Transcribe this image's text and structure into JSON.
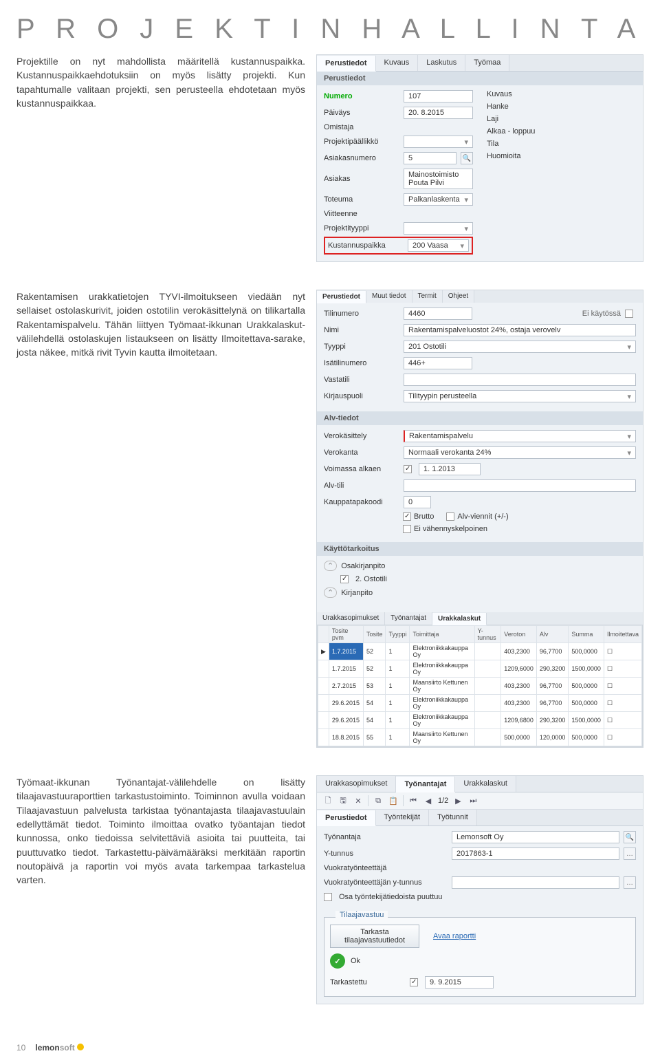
{
  "page": {
    "title_display": "P R O J E K T I N H A L L I N T A",
    "para1": "Projektille on nyt mahdollista määritellä kustannuspaikka. Kustannuspaikkaehdotuksiin on myös lisätty projekti. Kun tapahtumalle valitaan projekti, sen perusteella ehdotetaan myös kustannuspaikkaa.",
    "para2": "Rakentamisen urakkatietojen TYVI-ilmoitukseen viedään nyt sellaiset ostolaskurivit, joiden ostotilin verokäsittelynä on tilikartalla Rakentamispalvelu. Tähän liittyen Työmaat-ikkunan Urakkalaskut-välilehdellä ostolaskujen listaukseen on lisätty Ilmoitettava-sarake, josta näkee, mitkä rivit Tyvin kautta ilmoitetaan.",
    "para3": "Työmaat-ikkunan Työnantajat-välilehdelle on lisätty tilaajavastuuraporttien tarkastustoiminto. Toiminnon avulla voidaan Tilaajavastuun palvelusta tarkistaa työnantajasta tilaajavastuulain edellyttämät tiedot. Toiminto ilmoittaa ovatko työantajan tiedot kunnossa, onko tiedoissa selvitettäviä asioita tai puutteita, tai puuttuvatko tiedot. Tarkastettu-päivämääräksi merkitään raportin noutopäivä ja raportin voi myös avata tarkempaa tarkastelua varten."
  },
  "ui1": {
    "tabs": [
      "Perustiedot",
      "Kuvaus",
      "Laskutus",
      "Työmaa"
    ],
    "section_header": "Perustiedot",
    "left_labels": {
      "numero": "Numero",
      "paivays": "Päiväys",
      "omistaja": "Omistaja",
      "paallikko": "Projektipäällikkö",
      "asiakasnumero": "Asiakasnumero",
      "asiakas": "Asiakas",
      "toteuma": "Toteuma",
      "viitteenne": "Viitteenne",
      "prtyyppi": "Projektityyppi",
      "kustpaikka": "Kustannuspaikka"
    },
    "right_labels": {
      "kuvaus": "Kuvaus",
      "hanke": "Hanke",
      "laji": "Laji",
      "alkaaloppuu": "Alkaa - loppuu",
      "tila": "Tila",
      "huomioita": "Huomioita"
    },
    "values": {
      "numero": "107",
      "paivays": "20. 8.2015",
      "asiakasnumero": "5",
      "asiakas": "Mainostoimisto Pouta Pilvi",
      "toteuma": "Palkanlaskenta",
      "kustpaikka": "200 Vaasa"
    }
  },
  "ui2": {
    "tabs": [
      "Perustiedot",
      "Muut tiedot",
      "Termit",
      "Ohjeet"
    ],
    "labels": {
      "tilinumero": "Tilinumero",
      "nimi": "Nimi",
      "tyyppi": "Tyyppi",
      "isatilinumero": "Isätilinumero",
      "vastatili": "Vastatili",
      "kirjauspuoli": "Kirjauspuoli",
      "eikaytossa": "Ei käytössä"
    },
    "values": {
      "tilinumero": "4460",
      "nimi": "Rakentamispalveluostot 24%, ostaja verovelv",
      "tyyppi": "201 Ostotili",
      "isatilinumero": "446+",
      "kirjauspuoli": "Tilityypin perusteella"
    },
    "alv_header": "Alv-tiedot",
    "alv": {
      "verokasittely_label": "Verokäsittely",
      "verokasittely": "Rakentamispalvelu",
      "verokanta_label": "Verokanta",
      "verokanta": "Normaali verokanta 24%",
      "voimassa_label": "Voimassa alkaen",
      "voimassa": "1. 1.2013",
      "alvtili_label": "Alv-tili",
      "kauppa_label": "Kauppatapakoodi",
      "kauppa": "0",
      "brutto": "Brutto",
      "alvviennit": "Alv-viennit (+/-)",
      "eivahennys": "Ei vähennyskelpoinen"
    },
    "kt_header": "Käyttötarkoitus",
    "kt": {
      "osa": "Osakirjanpito",
      "toinen": "2. Ostotili",
      "kirj": "Kirjanpito"
    },
    "grid_tabs": [
      "Urakkasopimukset",
      "Työnantajat",
      "Urakkalaskut"
    ],
    "grid_headers": [
      "",
      "Tosite pvm",
      "Tosite",
      "Tyyppi",
      "Toimittaja",
      "Y-tunnus",
      "Veroton",
      "Alv",
      "Summa",
      "Ilmoitettava"
    ],
    "grid_rows": [
      [
        "▶",
        "1.7.2015",
        "52",
        "1",
        "Elektroniikkakauppa Oy",
        "",
        "403,2300",
        "96,7700",
        "500,0000",
        "☐"
      ],
      [
        "",
        "1.7.2015",
        "52",
        "1",
        "Elektroniikkakauppa Oy",
        "",
        "1209,6000",
        "290,3200",
        "1500,0000",
        "☐"
      ],
      [
        "",
        "2.7.2015",
        "53",
        "1",
        "Maansiirto Kettunen Oy",
        "",
        "403,2300",
        "96,7700",
        "500,0000",
        "☐"
      ],
      [
        "",
        "29.6.2015",
        "54",
        "1",
        "Elektroniikkakauppa Oy",
        "",
        "403,2300",
        "96,7700",
        "500,0000",
        "☐"
      ],
      [
        "",
        "29.6.2015",
        "54",
        "1",
        "Elektroniikkakauppa Oy",
        "",
        "1209,6800",
        "290,3200",
        "1500,0000",
        "☐"
      ],
      [
        "",
        "18.8.2015",
        "55",
        "1",
        "Maansiirto Kettunen Oy",
        "",
        "500,0000",
        "120,0000",
        "500,0000",
        "☐"
      ]
    ]
  },
  "ui3": {
    "tabs": [
      "Urakkasopimukset",
      "Työnantajat",
      "Urakkalaskut"
    ],
    "pager": "1/2",
    "subtabs": [
      "Perustiedot",
      "Työntekijät",
      "Työtunnit"
    ],
    "labels": {
      "tyonantaja": "Työnantaja",
      "ytunnus": "Y-tunnus",
      "vuokra": "Vuokratyönteettäjä",
      "vuokray": "Vuokratyönteettäjän y-tunnus",
      "puuttuu": "Osa työntekijätiedoista puuttuu"
    },
    "values": {
      "tyonantaja": "Lemonsoft Oy",
      "ytunnus": "2017863-1"
    },
    "tv": {
      "title": "Tilaajavastuu",
      "button": "Tarkasta\ntilaajavastuutiedot",
      "link": "Avaa raportti",
      "ok": "Ok",
      "tarkastettu_label": "Tarkastettu",
      "tarkastettu": "9. 9.2015"
    }
  },
  "footer": {
    "page": "10",
    "brand1": "lemon",
    "brand2": "soft"
  }
}
